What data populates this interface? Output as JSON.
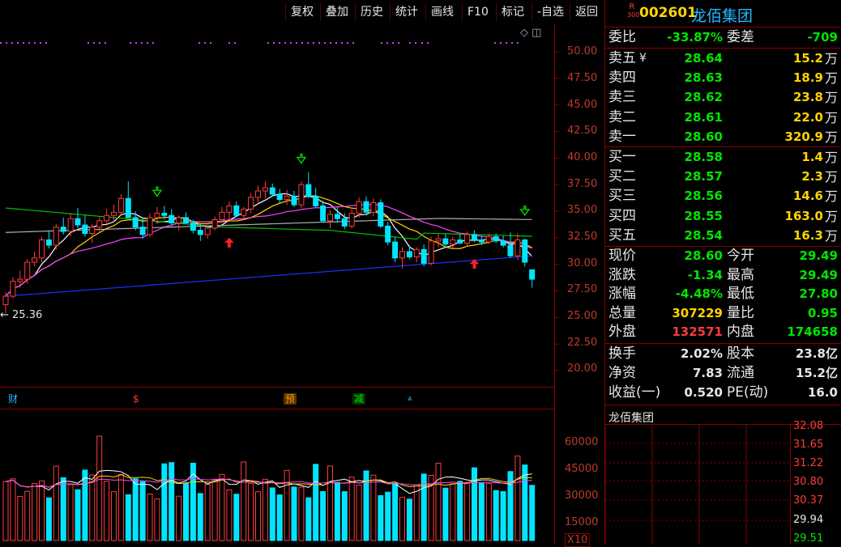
{
  "toolbar": {
    "items": [
      "复权",
      "叠加",
      "历史",
      "统计",
      "画线",
      "F10",
      "标记",
      "-自选",
      "返回"
    ]
  },
  "chart": {
    "low_marker_text": "← 25.36",
    "price_ticks": [
      "50.00",
      "47.50",
      "45.00",
      "42.50",
      "40.00",
      "37.50",
      "35.00",
      "32.50",
      "30.00",
      "27.50",
      "25.00",
      "22.50",
      "20.00"
    ],
    "volume_ticks": [
      "60000",
      "45000",
      "30000",
      "15000",
      "X10"
    ],
    "events": [
      {
        "label": "财",
        "color": "#22b8ff"
      },
      {
        "label": "$",
        "color": "#ff3b3b"
      },
      {
        "label": "预",
        "color": "#ff9900"
      },
      {
        "label": "减",
        "color": "#00e600"
      }
    ]
  },
  "quote": {
    "badge_top": "R",
    "badge_bottom": "300",
    "code": "002601",
    "name": "龙佰集团",
    "weibi_label": "委比",
    "weibi_value": "-33.87%",
    "weicha_label": "委差",
    "weicha_value": "-709",
    "sell": [
      {
        "label": "卖五",
        "mark": "¥",
        "price": "28.64",
        "vol": "15.2",
        "unit": "万"
      },
      {
        "label": "卖四",
        "mark": "",
        "price": "28.63",
        "vol": "18.9",
        "unit": "万"
      },
      {
        "label": "卖三",
        "mark": "",
        "price": "28.62",
        "vol": "23.8",
        "unit": "万"
      },
      {
        "label": "卖二",
        "mark": "",
        "price": "28.61",
        "vol": "22.0",
        "unit": "万"
      },
      {
        "label": "卖一",
        "mark": "",
        "price": "28.60",
        "vol": "320.9",
        "unit": "万"
      }
    ],
    "buy": [
      {
        "label": "买一",
        "price": "28.58",
        "vol": "1.4",
        "unit": "万"
      },
      {
        "label": "买二",
        "price": "28.57",
        "vol": "2.3",
        "unit": "万"
      },
      {
        "label": "买三",
        "price": "28.56",
        "vol": "14.6",
        "unit": "万"
      },
      {
        "label": "买四",
        "price": "28.55",
        "vol": "163.0",
        "unit": "万"
      },
      {
        "label": "买五",
        "price": "28.54",
        "vol": "16.3",
        "unit": "万"
      }
    ],
    "stats": [
      {
        "l1": "现价",
        "v1": "28.60",
        "c1": "green",
        "l2": "今开",
        "v2": "29.49",
        "c2": "green"
      },
      {
        "l1": "涨跌",
        "v1": "-1.34",
        "c1": "green",
        "l2": "最高",
        "v2": "29.49",
        "c2": "green"
      },
      {
        "l1": "涨幅",
        "v1": "-4.48%",
        "c1": "green",
        "l2": "最低",
        "v2": "27.80",
        "c2": "green"
      },
      {
        "l1": "总量",
        "v1": "307229",
        "c1": "yellow",
        "l2": "量比",
        "v2": "0.95",
        "c2": "green"
      },
      {
        "l1": "外盘",
        "v1": "132571",
        "c1": "red",
        "l2": "内盘",
        "v2": "174658",
        "c2": "green"
      }
    ],
    "fundamentals": [
      {
        "l1": "换手",
        "v1": "2.02%",
        "l2": "股本",
        "v2": "23.8亿"
      },
      {
        "l1": "净资",
        "v1": "7.83",
        "l2": "流通",
        "v2": "15.2亿"
      },
      {
        "l1": "收益(一)",
        "v1": "0.520",
        "l2": "PE(动)",
        "v2": "16.0"
      }
    ],
    "mini_title": "龙佰集团",
    "mini_ticks": [
      "32.08",
      "31.65",
      "31.22",
      "30.80",
      "30.37",
      "29.94",
      "29.51"
    ]
  },
  "colors": {
    "up": "#ff3b3b",
    "down": "#00e5ff",
    "ma5": "#ffffff",
    "ma10": "#ffd400",
    "ma20": "#ff44ff",
    "ma60": "#00c000",
    "ma120": "#2030ff",
    "ma250": "#b0b0b0"
  },
  "chart_data": {
    "type": "candlestick",
    "price_range": [
      20,
      52.5
    ],
    "candles": [
      [
        26.2,
        27.4,
        25.4,
        27.0
      ],
      [
        27.0,
        28.8,
        26.8,
        28.4
      ],
      [
        28.4,
        29.4,
        27.8,
        28.6
      ],
      [
        28.6,
        30.5,
        28.2,
        30.2
      ],
      [
        30.2,
        31.2,
        29.8,
        30.6
      ],
      [
        30.6,
        32.6,
        30.2,
        32.3
      ],
      [
        32.3,
        33.2,
        31.5,
        31.8
      ],
      [
        31.8,
        33.8,
        31.4,
        33.5
      ],
      [
        33.5,
        34.4,
        32.8,
        33.1
      ],
      [
        33.1,
        34.8,
        32.6,
        34.3
      ],
      [
        34.3,
        35.3,
        33.4,
        33.7
      ],
      [
        33.7,
        34.6,
        32.6,
        32.9
      ],
      [
        32.9,
        33.8,
        32.0,
        33.5
      ],
      [
        33.5,
        34.5,
        33.0,
        34.1
      ],
      [
        34.1,
        35.2,
        33.6,
        34.6
      ],
      [
        34.6,
        35.6,
        34.0,
        34.9
      ],
      [
        34.9,
        36.6,
        34.6,
        36.2
      ],
      [
        36.2,
        37.8,
        35.6,
        34.4
      ],
      [
        34.4,
        35.0,
        33.2,
        33.5
      ],
      [
        33.5,
        34.4,
        32.4,
        32.8
      ],
      [
        32.8,
        34.8,
        32.6,
        34.4
      ],
      [
        34.4,
        35.4,
        33.8,
        34.8
      ],
      [
        34.8,
        35.5,
        34.2,
        34.6
      ],
      [
        34.6,
        35.2,
        33.6,
        33.9
      ],
      [
        33.9,
        34.6,
        33.2,
        34.4
      ],
      [
        34.4,
        34.9,
        33.8,
        33.9
      ],
      [
        33.9,
        34.2,
        32.9,
        33.2
      ],
      [
        33.2,
        33.8,
        32.2,
        32.8
      ],
      [
        32.8,
        33.6,
        32.4,
        33.4
      ],
      [
        33.4,
        34.5,
        33.2,
        34.2
      ],
      [
        34.2,
        35.4,
        33.9,
        34.9
      ],
      [
        34.9,
        35.9,
        34.2,
        35.5
      ],
      [
        35.5,
        35.9,
        34.5,
        34.6
      ],
      [
        34.6,
        35.4,
        34.2,
        35.2
      ],
      [
        35.2,
        36.7,
        34.8,
        36.3
      ],
      [
        36.3,
        37.4,
        35.6,
        36.9
      ],
      [
        36.9,
        37.8,
        36.2,
        37.2
      ],
      [
        37.2,
        37.6,
        36.4,
        36.6
      ],
      [
        36.6,
        37.1,
        35.8,
        36.1
      ],
      [
        36.1,
        37.0,
        35.6,
        36.4
      ],
      [
        36.4,
        36.9,
        35.4,
        35.6
      ],
      [
        35.6,
        37.8,
        35.3,
        37.5
      ],
      [
        37.5,
        38.7,
        36.2,
        36.4
      ],
      [
        36.4,
        37.2,
        35.3,
        35.5
      ],
      [
        35.5,
        36.0,
        33.9,
        34.1
      ],
      [
        34.1,
        35.1,
        33.4,
        34.7
      ],
      [
        34.7,
        35.4,
        33.9,
        34.3
      ],
      [
        34.3,
        34.8,
        33.3,
        33.6
      ],
      [
        33.6,
        35.2,
        33.4,
        34.8
      ],
      [
        34.8,
        36.3,
        34.4,
        35.9
      ],
      [
        35.9,
        36.4,
        34.6,
        34.9
      ],
      [
        34.9,
        36.2,
        34.5,
        35.8
      ],
      [
        35.8,
        36.1,
        33.4,
        33.6
      ],
      [
        33.6,
        34.0,
        31.8,
        32.1
      ],
      [
        32.1,
        32.6,
        30.2,
        30.6
      ],
      [
        30.6,
        31.6,
        29.6,
        31.2
      ],
      [
        31.2,
        31.8,
        30.5,
        30.7
      ],
      [
        30.7,
        31.6,
        30.2,
        31.4
      ],
      [
        31.4,
        31.9,
        29.8,
        30.1
      ],
      [
        30.1,
        32.6,
        29.9,
        32.2
      ],
      [
        32.2,
        32.9,
        31.6,
        32.4
      ],
      [
        32.4,
        32.9,
        31.6,
        31.9
      ],
      [
        31.9,
        32.6,
        31.5,
        32.3
      ],
      [
        32.3,
        32.8,
        31.9,
        32.0
      ],
      [
        32.0,
        33.1,
        31.7,
        32.8
      ],
      [
        32.8,
        33.2,
        32.1,
        32.3
      ],
      [
        32.3,
        32.7,
        31.8,
        32.1
      ],
      [
        32.1,
        32.9,
        31.9,
        32.6
      ],
      [
        32.6,
        32.9,
        32.0,
        32.2
      ],
      [
        32.2,
        32.7,
        31.6,
        31.8
      ],
      [
        31.8,
        33.0,
        30.6,
        30.8
      ],
      [
        30.8,
        32.9,
        30.4,
        32.3
      ],
      [
        32.3,
        32.4,
        29.8,
        30.2
      ],
      [
        29.49,
        29.49,
        27.8,
        28.6
      ]
    ]
  }
}
